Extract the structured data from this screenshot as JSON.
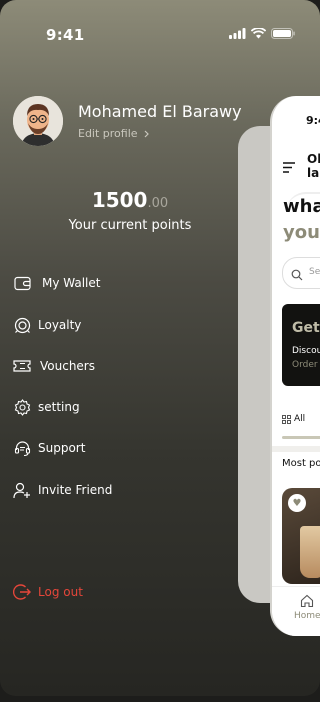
{
  "status_bar": {
    "time": "9:41"
  },
  "profile": {
    "name": "Mohamed El Barawy",
    "edit_label": "Edit profile"
  },
  "points": {
    "value": "1500",
    "decimals": ".00",
    "label": "Your current points"
  },
  "menu": [
    {
      "label": "My Wallet",
      "icon": "wallet-icon"
    },
    {
      "label": "Loyalty",
      "icon": "loyalty-icon"
    },
    {
      "label": "Vouchers",
      "icon": "ticket-icon"
    },
    {
      "label": "setting",
      "icon": "gear-icon"
    },
    {
      "label": "Support",
      "icon": "headset-icon"
    },
    {
      "label": "Invite Friend",
      "icon": "add-user-icon"
    }
  ],
  "logout": {
    "label": "Log out",
    "icon": "logout-icon"
  },
  "preview": {
    "time": "9:4",
    "title_line1": "Ol",
    "title_line2": "la",
    "headline_line1": "wha",
    "headline_line2": "you",
    "search_placeholder": "Sea",
    "promo_title": "Get",
    "promo_line1": "Discou",
    "promo_line2": "Order",
    "category_all": "All",
    "section_title": "Most po",
    "nav_home": "Home"
  },
  "colors": {
    "accent": "#8d8b78",
    "logout": "#e5463a"
  }
}
